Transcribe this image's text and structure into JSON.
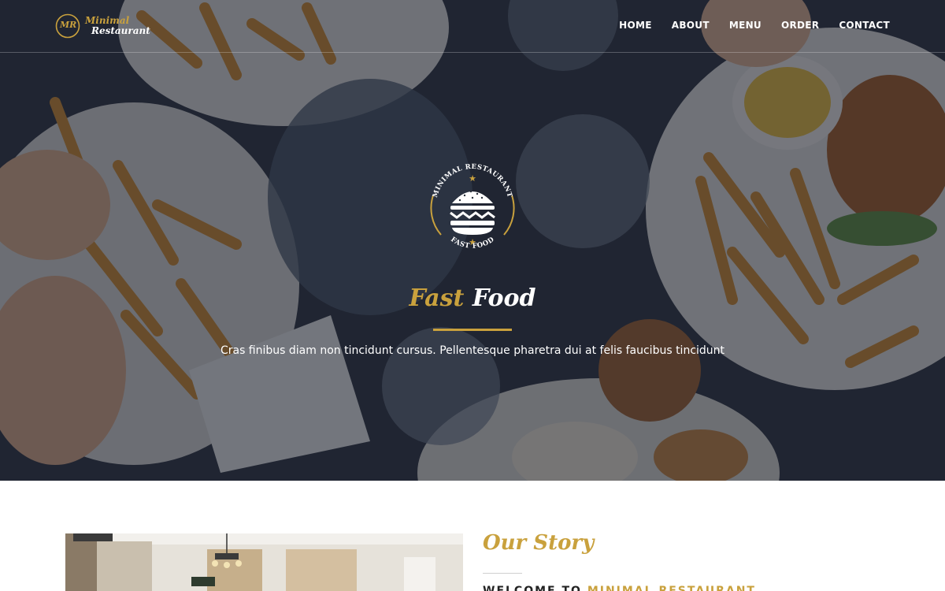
{
  "colors": {
    "accent": "#c9a13d",
    "hero_overlay": "#181e2c",
    "white": "#ffffff",
    "dark_text": "#222222"
  },
  "header": {
    "logo": {
      "monogram": "MR",
      "line1": "Minimal",
      "line2": "Restaurant"
    },
    "nav": [
      {
        "label": "HOME"
      },
      {
        "label": "ABOUT"
      },
      {
        "label": "MENU"
      },
      {
        "label": "ORDER"
      },
      {
        "label": "CONTACT"
      }
    ]
  },
  "hero": {
    "emblem": {
      "top_text": "MINIMAL RESTAURANT",
      "bottom_text": "FAST FOOD",
      "icon": "burger-icon"
    },
    "title_part1": "Fast",
    "title_part2": "Food",
    "subtitle": "Cras finibus diam non tincidunt cursus. Pellentesque pharetra dui at felis faucibus tincidunt"
  },
  "story": {
    "title": "Our Story",
    "welcome_prefix": "WELCOME TO",
    "welcome_highlight": "MINIMAL RESTAURANT"
  }
}
